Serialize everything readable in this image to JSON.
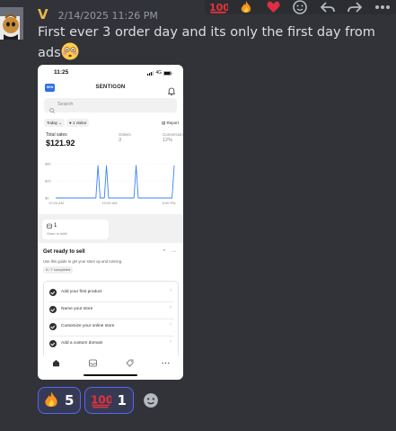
{
  "message": {
    "username": "V",
    "timestamp": "2/14/2025 11:26 PM",
    "text_line1": "First ever 3 order day and its only the first day from",
    "text_line2": "ads"
  },
  "action_bar": {
    "items": [
      "hundred-points-emoji",
      "fire-emoji",
      "heart-emoji",
      "add-reaction-icon",
      "reply-icon",
      "forward-icon",
      "more-icon"
    ]
  },
  "attachment": {
    "status_time": "11:25",
    "network": "4G",
    "app_logo": "SEN",
    "app_name": "SENTIGON",
    "search_placeholder": "Search",
    "filter_today": "Today",
    "filter_visitors": "1 visitor",
    "report_label": "Report",
    "total_sales_label": "Total sales",
    "total_sales_value": "$121.92",
    "orders_label": "Orders",
    "orders_value": "3",
    "conversion_label": "Conversion",
    "conversion_value": "12%",
    "orders_card_count": "1",
    "orders_card_label": "Order to fulfill",
    "guide_title": "Get ready to sell",
    "guide_desc": "Use this guide to get your store up and running.",
    "guide_progress": "0 / 7 completed",
    "tasks": [
      "Add your first product",
      "Name your store",
      "Customize your online store",
      "Add a custom domain"
    ],
    "tabbar": [
      "home-icon",
      "inbox-icon",
      "tag-icon",
      "more-icon"
    ]
  },
  "chart_data": {
    "type": "line",
    "x": [
      "12:00 AM",
      "10:00 AM",
      "8:00 PM"
    ],
    "ytick_labels": [
      "$40",
      "$20",
      "$0"
    ],
    "ylim": [
      0,
      40
    ],
    "series": [
      {
        "points": [
          [
            0,
            0
          ],
          [
            4,
            0
          ],
          [
            8,
            0
          ],
          [
            12,
            0
          ],
          [
            16,
            0
          ],
          [
            19,
            0
          ],
          [
            20,
            38
          ],
          [
            21,
            0
          ],
          [
            23,
            0
          ],
          [
            24,
            38
          ],
          [
            25,
            0
          ],
          [
            29,
            0
          ],
          [
            33,
            0
          ],
          [
            37,
            0
          ],
          [
            38,
            38
          ],
          [
            39,
            0
          ],
          [
            44,
            0
          ],
          [
            48,
            0
          ],
          [
            52,
            0
          ],
          [
            55,
            0
          ],
          [
            56,
            38
          ]
        ]
      }
    ],
    "colors": {
      "line": "#3b82f6",
      "grid": "#e9e9e9"
    }
  },
  "reactions": [
    {
      "emoji": "fire-emoji",
      "count": "5"
    },
    {
      "emoji": "hundred-points-emoji",
      "count": "1"
    }
  ],
  "colors": {
    "background": "#323339",
    "username": "#e8b84a",
    "reaction_border": "#5865f2",
    "reaction_bg": "#373a54"
  }
}
